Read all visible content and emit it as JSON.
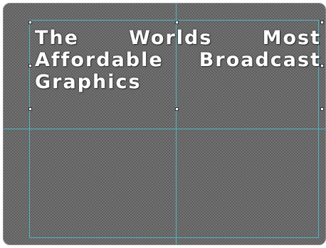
{
  "title_lines": {
    "line1": "The Worlds Most",
    "line2": "Affordable Broadcast",
    "line3": "Graphics"
  },
  "colors": {
    "guide": "#4fb6c4",
    "checker_light": "#737373",
    "checker_dark": "#5e5e5e",
    "text": "#ffffff"
  }
}
